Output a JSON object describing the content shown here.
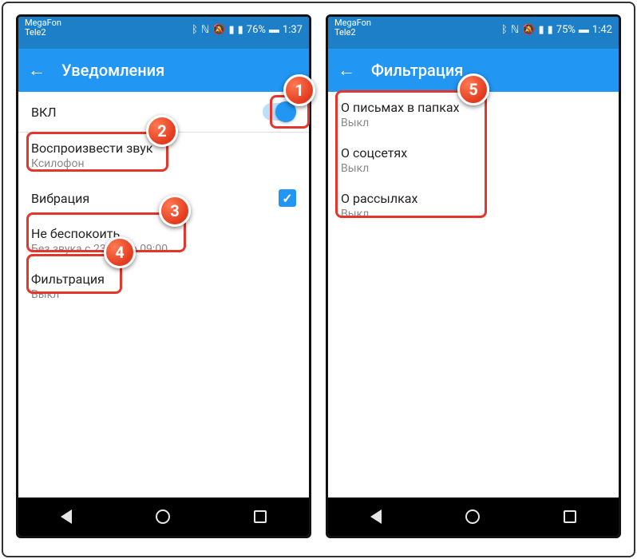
{
  "left": {
    "statusbar": {
      "carrier1": "MegaFon",
      "carrier2": "Tele2",
      "battery": "76%",
      "time": "1:37"
    },
    "appbar": {
      "title": "Уведомления"
    },
    "rows": {
      "enable": {
        "label": "ВКЛ"
      },
      "sound": {
        "label": "Воспроизвести звук",
        "value": "Ксилофон"
      },
      "vibrate": {
        "label": "Вибрация"
      },
      "dnd": {
        "label": "Не беспокоить",
        "value": "Без звука с 23:00 до 09:00"
      },
      "filter": {
        "label": "Фильтрация",
        "value": "Выкл"
      }
    }
  },
  "right": {
    "statusbar": {
      "carrier1": "MegaFon",
      "carrier2": "Tele2",
      "battery": "75%",
      "time": "1:42"
    },
    "appbar": {
      "title": "Фильтрация"
    },
    "rows": {
      "folders": {
        "label": "О письмах в папках",
        "value": "Выкл"
      },
      "social": {
        "label": "О соцсетях",
        "value": "Выкл"
      },
      "mailings": {
        "label": "О рассылках",
        "value": "Выкл"
      }
    }
  },
  "callouts": {
    "c1": "1",
    "c2": "2",
    "c3": "3",
    "c4": "4",
    "c5": "5"
  }
}
